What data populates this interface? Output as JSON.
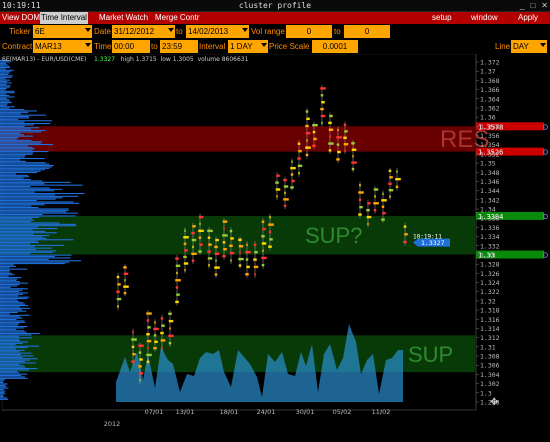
{
  "window": {
    "clock": "10:19:11",
    "title": "cluster profile"
  },
  "menu": {
    "left": [
      {
        "label": "View DOM",
        "active": false
      },
      {
        "label": "Time Interval",
        "active": true
      },
      {
        "label": "Market Watch",
        "active": false
      },
      {
        "label": "Merge Contr",
        "active": false
      }
    ],
    "right": [
      "setup",
      "window",
      "Apply"
    ]
  },
  "toolbar": {
    "ticker_label": "Ticker",
    "ticker": "6E",
    "date_label": "Date",
    "date_from": "31/12/2012",
    "date_to_label": "to",
    "date_to": "14/02/2013",
    "vol_range_label": "Vol range",
    "vol_from": "0",
    "vol_to_label": "to",
    "vol_to": "0",
    "contract_label": "Contract",
    "contract": "MAR13",
    "time_label": "Time",
    "time_from": "00:00",
    "time_to_label": "to",
    "time_to": "23:59",
    "interval_label": "Interval",
    "interval": "1 DAY",
    "price_scale_label": "Price Scale",
    "price_scale": "0.0001",
    "line_label": "Line",
    "line": "DAY"
  },
  "info": {
    "symbol": "6E(MAR13) - EUR/USD(CME)",
    "last": "1.3327",
    "high": "high 1.3715",
    "low": "low 1.3005",
    "volume": "volume 8606631"
  },
  "zones": [
    {
      "label": "RES",
      "top_price": 1.358,
      "bottom_price": 1.3525,
      "color": "#8b0000",
      "tag1": "1.3578",
      "tag2": "1.3526"
    },
    {
      "label": "SUP?",
      "top_price": 1.3385,
      "bottom_price": 1.3301,
      "color": "#0b4d0b",
      "tag1": "1.3384",
      "tag2": "1.33"
    },
    {
      "label": "SUP",
      "top_price": 1.3125,
      "bottom_price": 1.3045,
      "color": "#0b4d0b",
      "tag1": "",
      "tag2": ""
    }
  ],
  "current_price": {
    "time": "10:19:11",
    "price": "1.3327"
  },
  "price_axis": [
    "1.372",
    "1.37",
    "1.368",
    "1.366",
    "1.364",
    "1.362",
    "1.36",
    "1.358",
    "1.356",
    "1.354",
    "1.352",
    "1.35",
    "1.348",
    "1.346",
    "1.344",
    "1.342",
    "1.34",
    "1.338",
    "1.336",
    "1.334",
    "1.332",
    "1.33",
    "1.328",
    "1.326",
    "1.324",
    "1.322",
    "1.32",
    "1.318",
    "1.316",
    "1.314",
    "1.312",
    "1.31",
    "1.308",
    "1.306",
    "1.304",
    "1.302",
    "1.3",
    "1.298"
  ],
  "time_axis": [
    "07/01",
    "13/01",
    "18/01",
    "24/01",
    "30/01",
    "05/02",
    "11/02"
  ],
  "year_label": "2012",
  "colors": {
    "menu_bg": "#b30000",
    "field_bg": "#ffa500",
    "label": "#ff8c00",
    "profile": "#1e6fd9",
    "volume": "#2a8fd0"
  }
}
